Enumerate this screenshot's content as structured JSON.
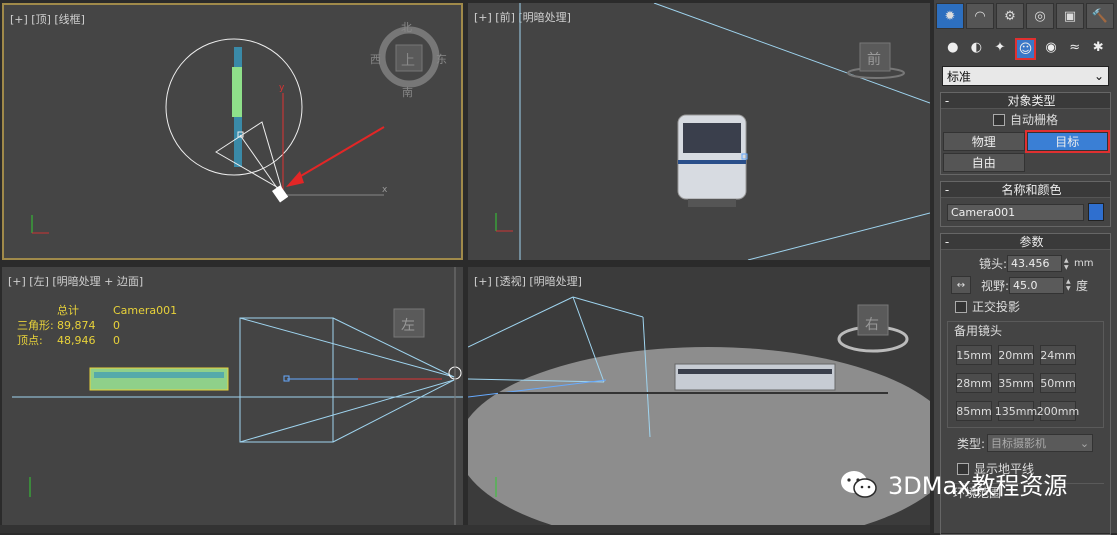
{
  "viewports": {
    "top": {
      "label": "[+] [顶] [线框]",
      "compass": {
        "n": "北",
        "s": "南",
        "w": "西",
        "e": "东",
        "cube": "上"
      },
      "axis_x": "x",
      "axis_y": "y"
    },
    "front": {
      "label": "[+] [前] [明暗处理]",
      "cube": "前"
    },
    "left": {
      "label": "[+] [左] [明暗处理 + 边面]",
      "cube": "左",
      "stats": {
        "header_total": "总计",
        "header_obj": "Camera001",
        "rows": [
          {
            "name": "三角形:",
            "total": "89,874",
            "obj": "0"
          },
          {
            "name": "顶点:",
            "total": "48,946",
            "obj": "0"
          }
        ]
      }
    },
    "persp": {
      "label": "[+] [透视] [明暗处理]",
      "cube": "右"
    }
  },
  "panel": {
    "tabs": [
      "✹",
      "◠",
      "⚙",
      "◎",
      "▣",
      "🔨"
    ],
    "subtabs": [
      "●",
      "◐",
      "✦",
      "☺",
      "◉",
      "≈",
      "✱"
    ],
    "dropdown": "标准",
    "object_type": {
      "title": "对象类型",
      "auto_grid": "自动栅格",
      "buttons": [
        "物理",
        "目标",
        "自由"
      ],
      "selected": "目标"
    },
    "name_color": {
      "title": "名称和颜色",
      "name": "Camera001",
      "color": "#2f6fcf"
    },
    "params": {
      "title": "参数",
      "lens_label": "镜头:",
      "lens_value": "43.456",
      "lens_unit": "mm",
      "fov_label": "视野:",
      "fov_value": "45.0",
      "fov_unit": "度",
      "ortho": "正交投影",
      "stock_title": "备用镜头",
      "stock": [
        "15mm",
        "20mm",
        "24mm",
        "28mm",
        "35mm",
        "50mm",
        "85mm",
        "135mm",
        "200mm"
      ],
      "type_label": "类型:",
      "type_value": "目标摄影机",
      "show_horizon": "显示地平线",
      "env_range": "环境范围"
    }
  },
  "watermark": "3DMax教程资源"
}
